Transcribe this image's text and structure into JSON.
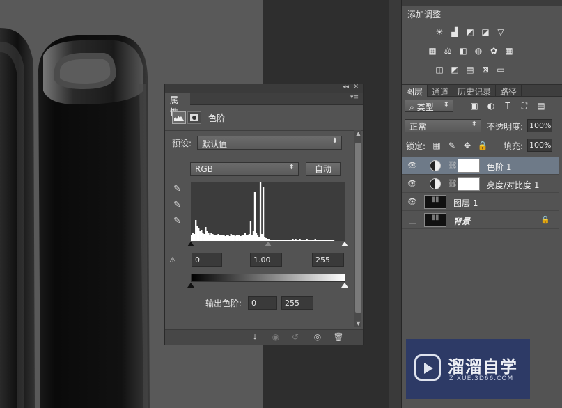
{
  "properties_panel": {
    "tab_label": "属性",
    "collapse_label": "◂◂",
    "close_label": "✕",
    "menu_label": "▾≡",
    "title": "色阶",
    "preset_label": "预设:",
    "preset_value": "默认值",
    "channel_value": "RGB",
    "auto_button": "自动",
    "input_black": "0",
    "input_gamma": "1.00",
    "input_white": "255",
    "output_label": "输出色阶:",
    "output_black": "0",
    "output_white": "255"
  },
  "adjustments_panel": {
    "title": "添加调整"
  },
  "layers_panel": {
    "tabs": [
      "图层",
      "通道",
      "历史记录",
      "路径"
    ],
    "filter_kind": "类型",
    "blend_mode": "正常",
    "opacity_label": "不透明度:",
    "opacity_value": "100%",
    "lock_label": "锁定:",
    "fill_label": "填充:",
    "fill_value": "100%",
    "layers": [
      {
        "name": "色阶 1",
        "visible": true,
        "selected": true
      },
      {
        "name": "亮度/对比度 1",
        "visible": true,
        "selected": false
      },
      {
        "name": "图层 1",
        "visible": true,
        "selected": false
      },
      {
        "name": "背景",
        "visible": false,
        "selected": false
      }
    ]
  },
  "watermark": {
    "title": "溜溜自学",
    "url": "ZIXUE.3D66.COM"
  },
  "histogram_data": {
    "type": "histogram",
    "levels": [
      8,
      12,
      10,
      30,
      22,
      18,
      14,
      16,
      12,
      10,
      20,
      14,
      11,
      9,
      12,
      10,
      9,
      8,
      8,
      10,
      9,
      8,
      9,
      8,
      7,
      9,
      8,
      7,
      10,
      9,
      8,
      7,
      9,
      8,
      8,
      7,
      9,
      8,
      12,
      8,
      9,
      10,
      28,
      9,
      14,
      70,
      12,
      8,
      6,
      85,
      10,
      78,
      6,
      4,
      3,
      3,
      2,
      2,
      2,
      2,
      2,
      2,
      2,
      2,
      2,
      2,
      2,
      2,
      2,
      2,
      2,
      2,
      3,
      2,
      3,
      2,
      2,
      3,
      2,
      2,
      2,
      2,
      3,
      2,
      2,
      2,
      2,
      2,
      3,
      2,
      2,
      2,
      2,
      2,
      2,
      2,
      1,
      1,
      1,
      1,
      1,
      1,
      0,
      0,
      0,
      0,
      0,
      0,
      0,
      0
    ]
  }
}
